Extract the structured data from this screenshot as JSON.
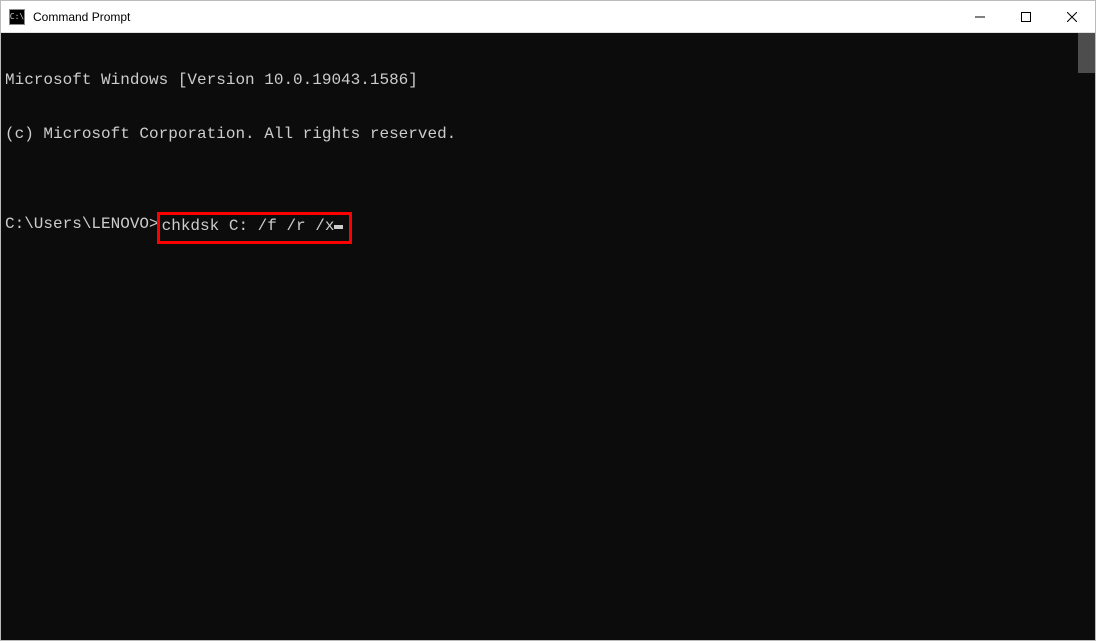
{
  "window": {
    "title": "Command Prompt"
  },
  "terminal": {
    "line1": "Microsoft Windows [Version 10.0.19043.1586]",
    "line2": "(c) Microsoft Corporation. All rights reserved.",
    "blank": "",
    "prompt": "C:\\Users\\LENOVO>",
    "command": "chkdsk C: /f /r /x"
  }
}
